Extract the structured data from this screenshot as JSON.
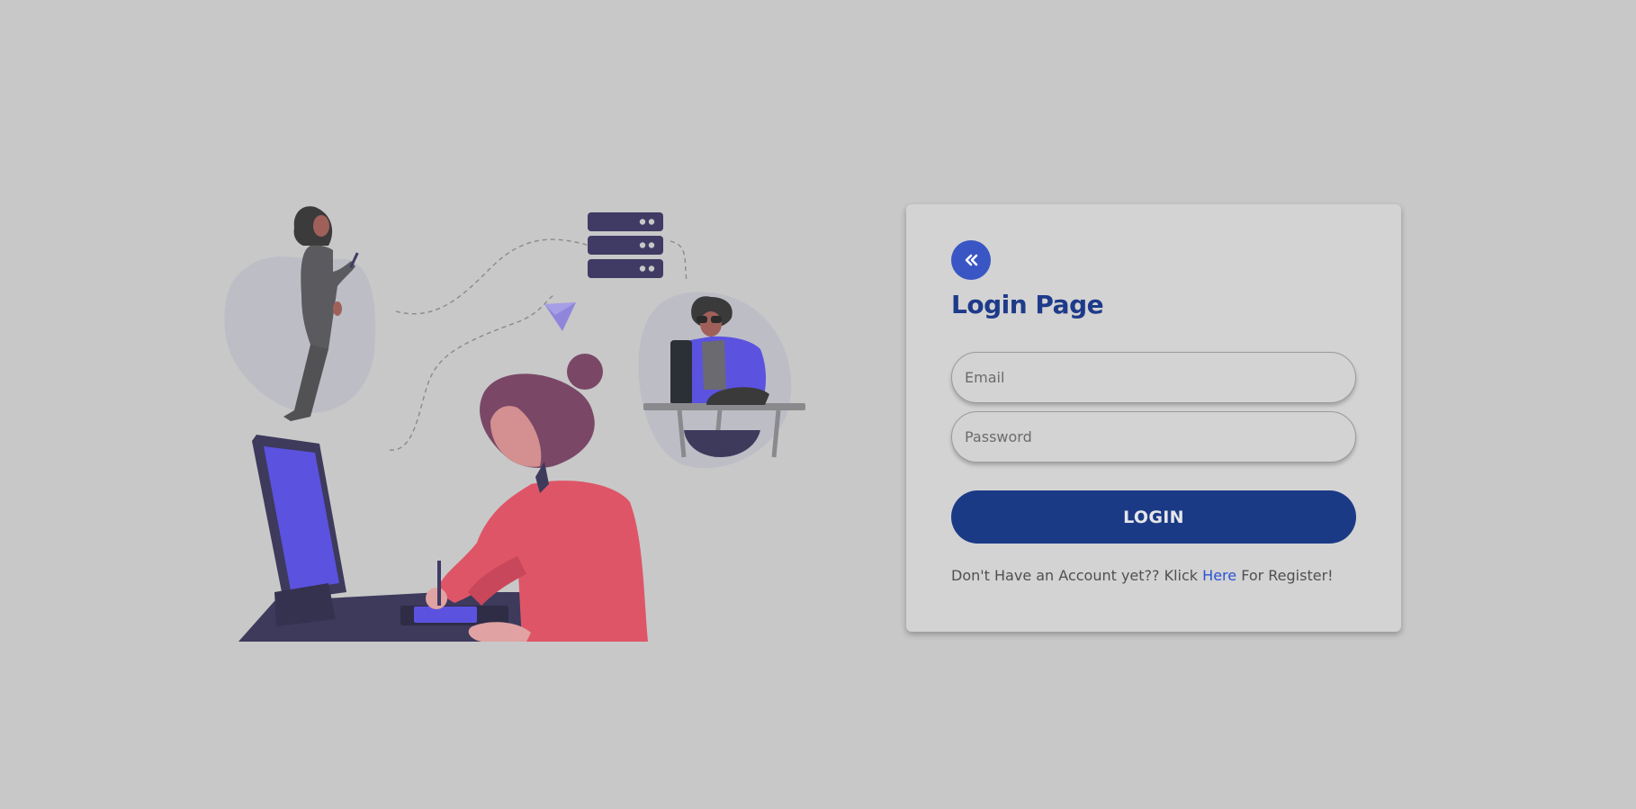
{
  "colors": {
    "background": "#c8c8c8",
    "card": "#d3d3d3",
    "primary": "#1b3a86",
    "title": "#1e3a8a",
    "back_button": "#3a56c4",
    "link": "#2b53d6",
    "illustration_accent": "#5b52e0",
    "illustration_dark": "#3d3a5c",
    "illustration_red": "#de5567"
  },
  "icons": {
    "back": "double-chevron-left-icon"
  },
  "login": {
    "title": "Login Page",
    "email_placeholder": "Email",
    "password_placeholder": "Password",
    "submit_label": "LOGIN",
    "register_prefix": "Don't Have an Account yet?? Klick ",
    "register_link": "Here",
    "register_suffix": " For Register!"
  }
}
